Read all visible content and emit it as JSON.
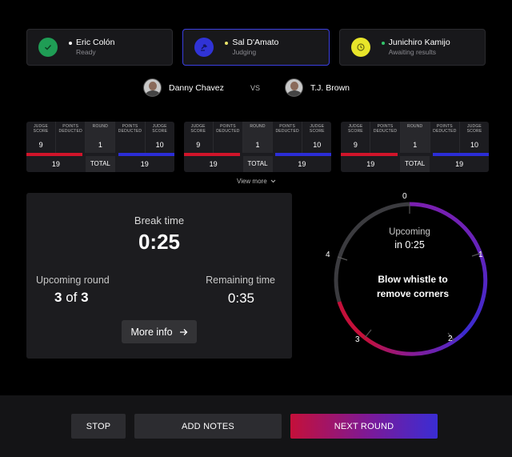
{
  "judges": [
    {
      "name": "Eric Colón",
      "status": "Ready",
      "icon": "check-icon",
      "icon_bg": "#1f9d55",
      "dot": "#ffffff"
    },
    {
      "name": "Sal D'Amato",
      "status": "Judging",
      "icon": "gavel-icon",
      "icon_bg": "#3033d6",
      "dot": "#e9e36a"
    },
    {
      "name": "Junichiro Kamijo",
      "status": "Awaiting results",
      "icon": "clock-icon",
      "icon_bg": "#e8e52a",
      "dot": "#32c56a"
    }
  ],
  "fighters": {
    "red": "Danny Chavez",
    "vs": "VS",
    "blue": "T.J. Brown"
  },
  "score_headers": {
    "judge_score": "JUDGE SCORE",
    "points_deducted": "POINTS DEDUCTED",
    "round": "ROUND",
    "total": "TOTAL"
  },
  "score_cards": [
    {
      "red_score": "9",
      "round": "1",
      "blue_score": "10",
      "red_total": "19",
      "blue_total": "19"
    },
    {
      "red_score": "9",
      "round": "1",
      "blue_score": "10",
      "red_total": "19",
      "blue_total": "19"
    },
    {
      "red_score": "9",
      "round": "1",
      "blue_score": "10",
      "red_total": "19",
      "blue_total": "19"
    }
  ],
  "view_more": "View more",
  "timer": {
    "break_label": "Break time",
    "break_value": "0:25",
    "upcoming_label": "Upcoming round",
    "upcoming_current": "3",
    "upcoming_of": "of",
    "upcoming_total": "3",
    "remaining_label": "Remaining time",
    "remaining_value": "0:35",
    "more_info": "More info"
  },
  "dial": {
    "upcoming_label": "Upcoming",
    "upcoming_time": "in 0:25",
    "message": "Blow whistle to remove corners",
    "numbers": [
      "0",
      "1",
      "2",
      "3",
      "4"
    ]
  },
  "footer": {
    "stop": "STOP",
    "add_notes": "ADD NOTES",
    "next_round": "NEXT ROUND"
  },
  "colors": {
    "red": "#d0142a",
    "blue": "#2b2dd6",
    "purple": "#7a1a9a",
    "active_border": "#3b3fe0"
  }
}
